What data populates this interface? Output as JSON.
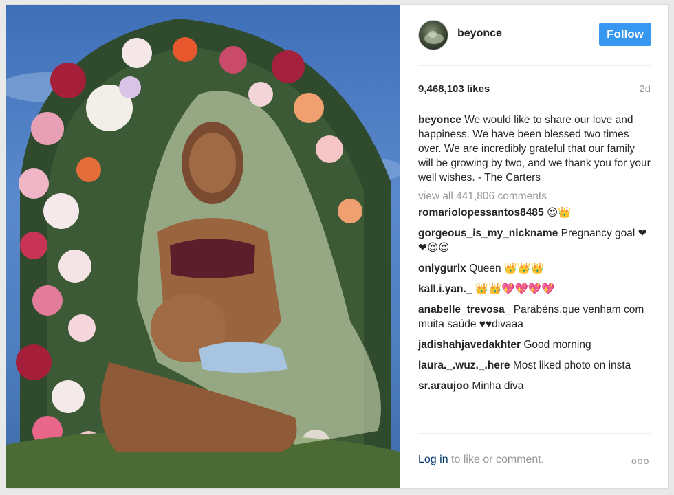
{
  "post": {
    "username": "beyonce",
    "follow_label": "Follow",
    "likes": "9,468,103 likes",
    "age": "2d",
    "caption_user": "beyonce",
    "caption_text": "We would like to share our love and happiness. We have been blessed two times over. We are incredibly grateful that our family will be growing by two, and we thank you for your well wishes. - The Carters",
    "view_all": "view all 441,806 comments",
    "comments": [
      {
        "user": "romariolopessantos8485",
        "text": "😍👑"
      },
      {
        "user": "gorgeous_is_my_nickname",
        "text": "Pregnancy goal ❤❤😍😍"
      },
      {
        "user": "onlygurlx",
        "text": "Queen 👑👑👑"
      },
      {
        "user": "kall.i.yan._",
        "text": "👑👑💖💖💖💖"
      },
      {
        "user": "anabelle_trevosa_",
        "text": "Parabéns,que venham com muita saúde ♥♥divaaa"
      },
      {
        "user": "jadishahjavedakhter",
        "text": "Good morning"
      },
      {
        "user": "laura._.wuz._.here",
        "text": "Most liked photo on insta"
      },
      {
        "user": "sr.araujoo",
        "text": "Minha diva"
      }
    ],
    "login_link": "Log in",
    "login_rest": " to like or comment.",
    "more_icon": "ooo"
  },
  "colors": {
    "follow_bg": "#3897f0",
    "link": "#003569",
    "muted": "#999999"
  }
}
